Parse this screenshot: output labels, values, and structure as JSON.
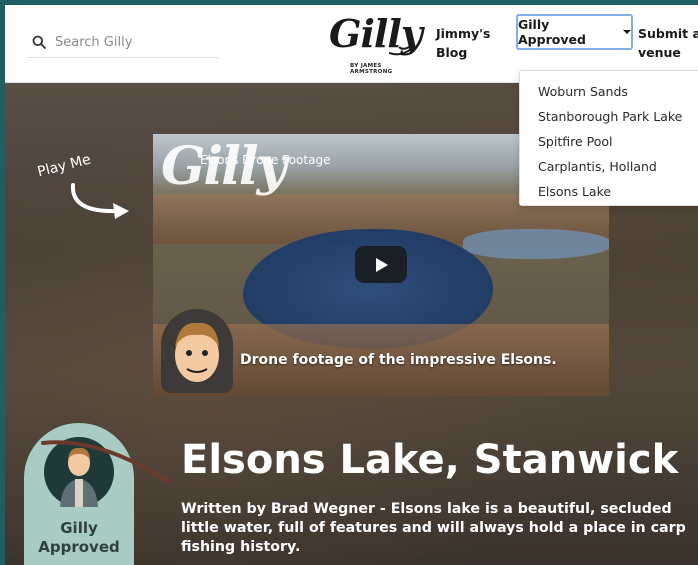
{
  "search": {
    "placeholder": "Search Gilly"
  },
  "logo": {
    "wordmark": "Gilly",
    "byline": "BY JAMES ARMSTRONG"
  },
  "nav": {
    "blog_label": "Jimmy's Blog",
    "approved_label": "Gilly Approved",
    "submit_label": "Submit a venue"
  },
  "dropdown": {
    "items": [
      {
        "label": "Woburn Sands"
      },
      {
        "label": "Stanborough Park Lake"
      },
      {
        "label": "Spitfire Pool"
      },
      {
        "label": "Carplantis, Holland"
      },
      {
        "label": "Elsons Lake"
      }
    ]
  },
  "hero": {
    "play_me": "Play Me",
    "video": {
      "logo": "Gilly",
      "title": "Elsons Drone Footage",
      "caption": "Drone footage of the impressive Elsons."
    },
    "badge": {
      "line1": "Gilly",
      "line2": "Approved"
    },
    "title": "Elsons Lake, Stanwick",
    "description": "Written by Brad Wegner - Elsons lake is a beautiful, secluded little water, full of features and will always hold a place in carp fishing history."
  }
}
